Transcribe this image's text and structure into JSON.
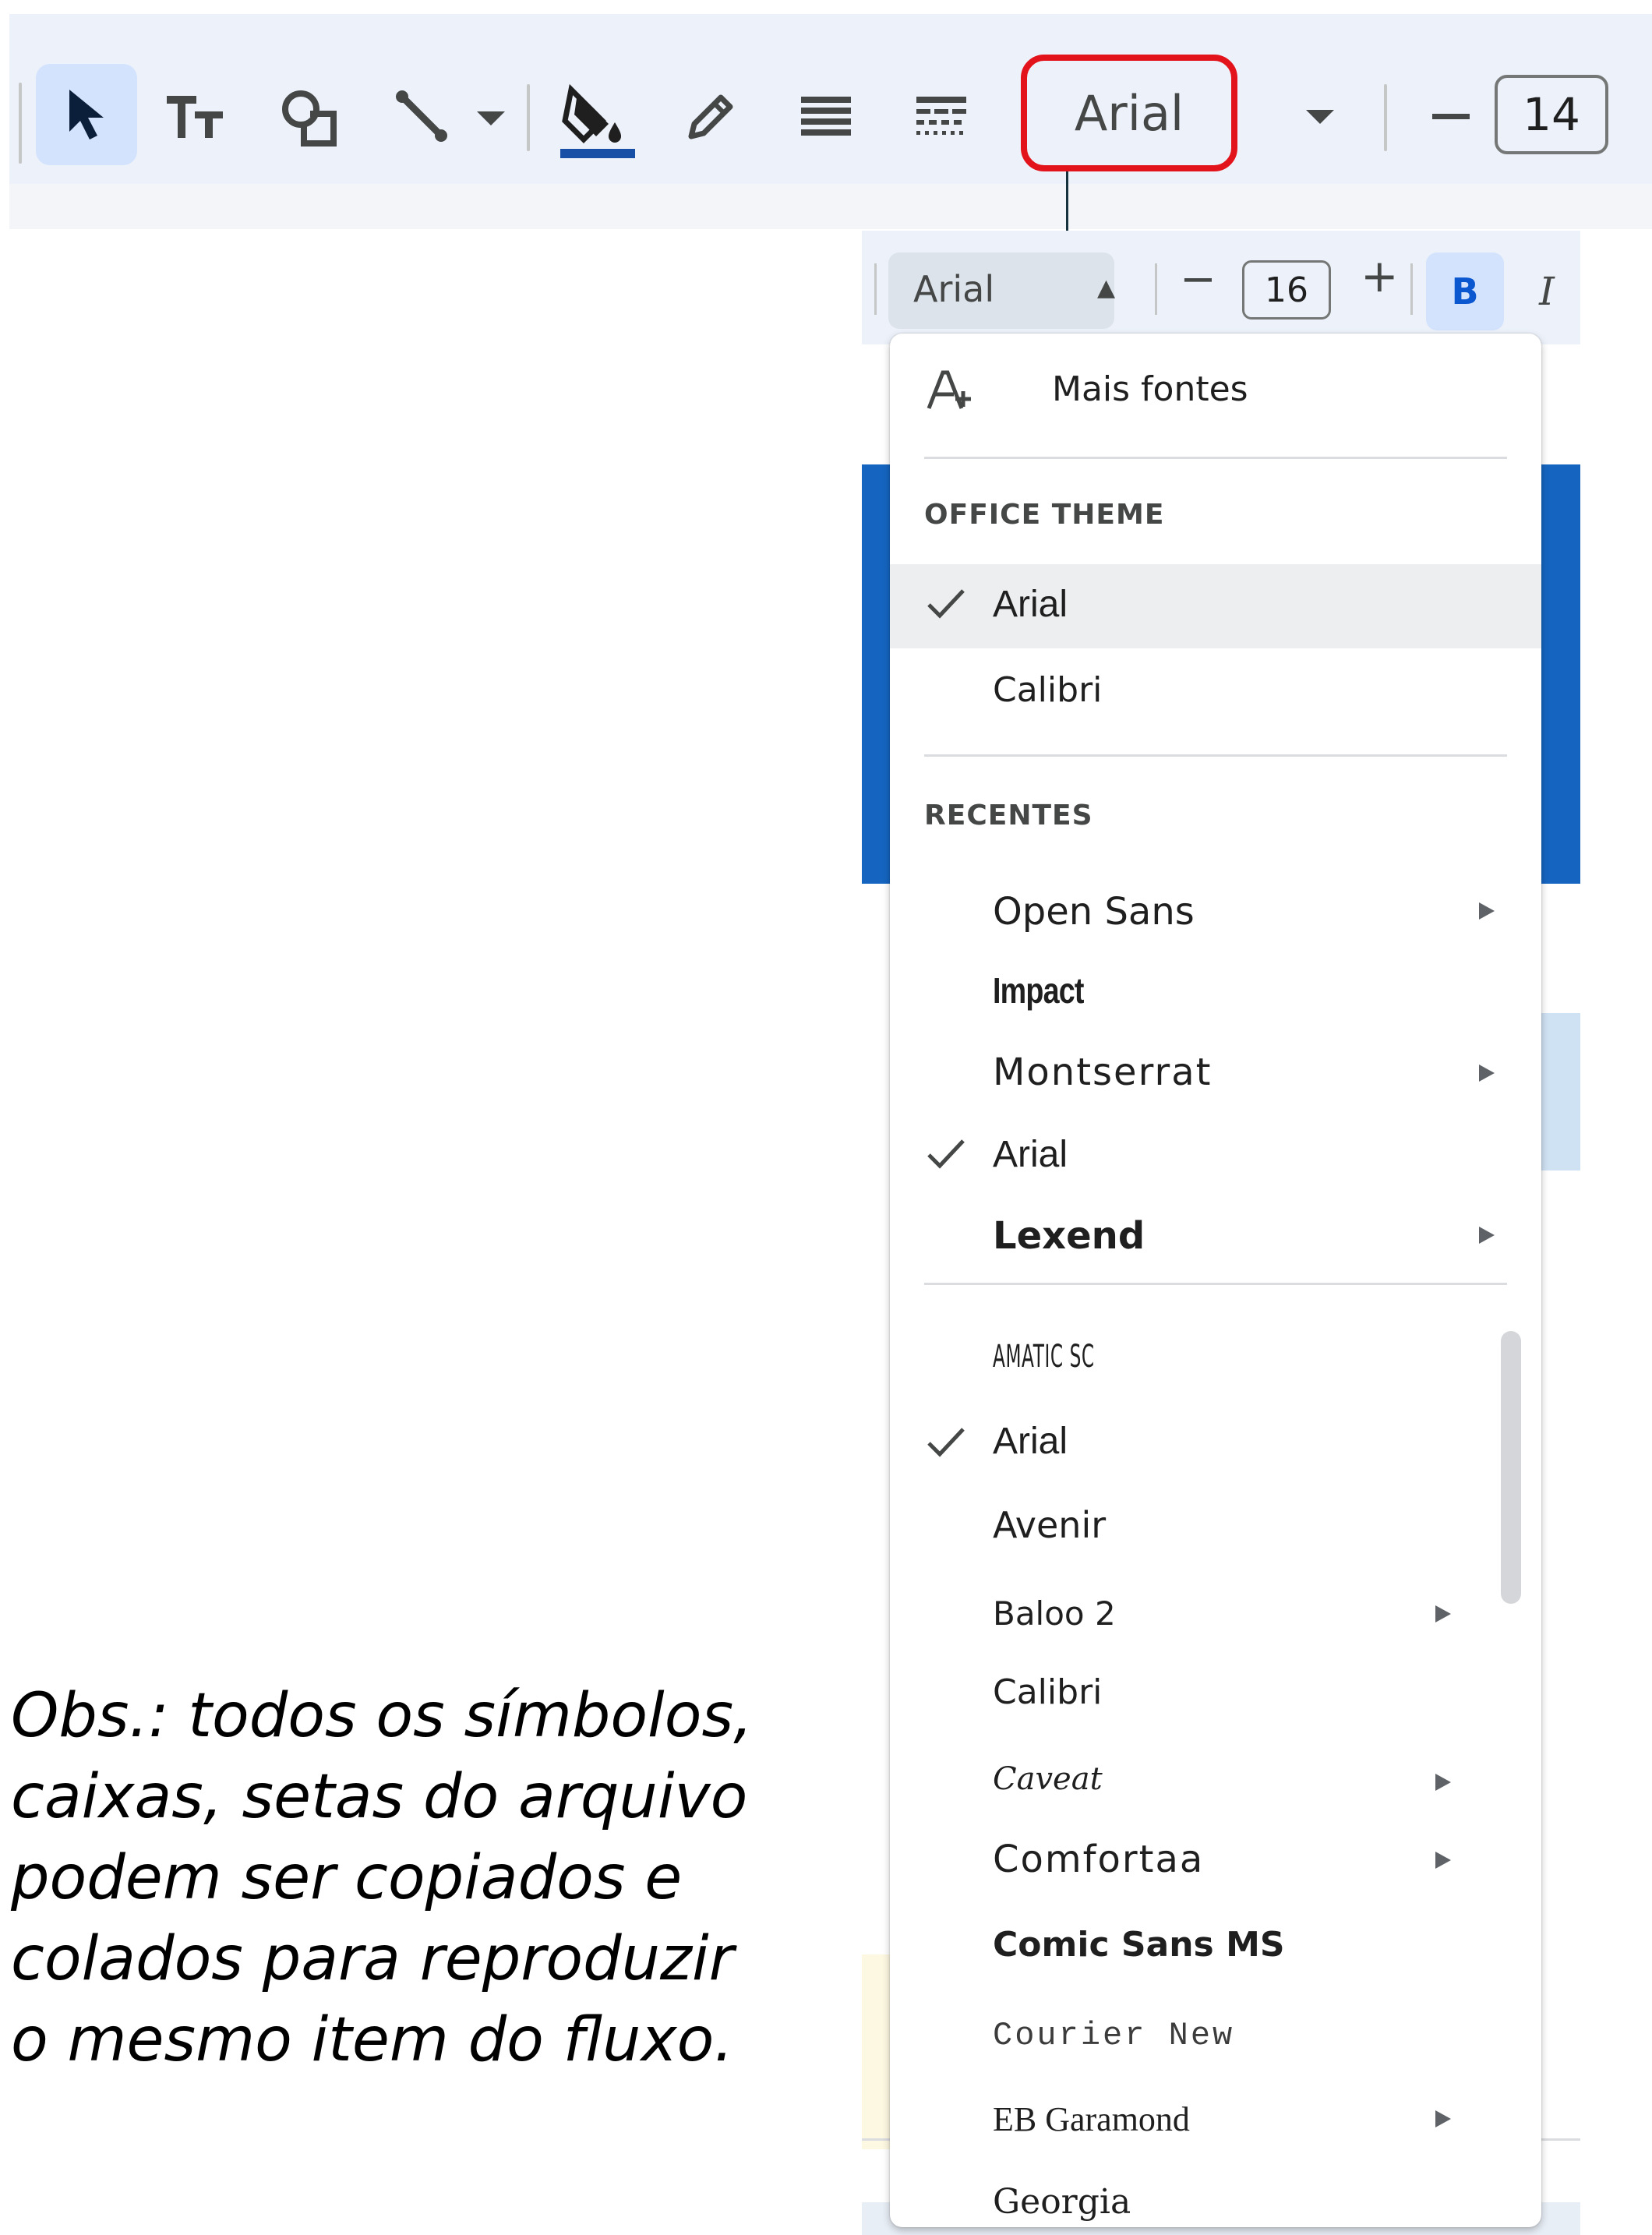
{
  "toolbar": {
    "font_name": "Arial",
    "font_size": "14",
    "accent": "#0b57d0",
    "highlight_color": "#e3131b",
    "icons": [
      "select-icon",
      "text-style-icon",
      "shapes-icon",
      "line-icon",
      "dropdown-icon",
      "fill-color-icon",
      "pen-icon",
      "line-weight-icon",
      "line-dash-icon",
      "font-dropdown-icon",
      "minus-icon"
    ]
  },
  "app": {
    "font_name": "Arial",
    "font_size": "16",
    "minus": "−",
    "plus": "+",
    "bold": "B",
    "italic": "I"
  },
  "menu": {
    "more_fonts": "Mais fontes",
    "office_theme_header": "OFFICE THEME",
    "office_theme": [
      {
        "label": "Arial",
        "checked": true,
        "selected": true
      },
      {
        "label": "Calibri",
        "checked": false
      }
    ],
    "recent_header": "RECENTES",
    "recent": [
      {
        "label": "Open Sans",
        "submenu": true
      },
      {
        "label": "Impact",
        "submenu": false
      },
      {
        "label": "Montserrat",
        "submenu": true
      },
      {
        "label": "Arial",
        "checked": true
      },
      {
        "label": "Lexend",
        "submenu": true
      }
    ],
    "all": [
      {
        "label": "AMATIC SC"
      },
      {
        "label": "Arial",
        "checked": true
      },
      {
        "label": "Avenir"
      },
      {
        "label": "Baloo 2",
        "submenu": true
      },
      {
        "label": "Calibri"
      },
      {
        "label": "Caveat",
        "submenu": true
      },
      {
        "label": "Comfortaa",
        "submenu": true
      },
      {
        "label": "Comic Sans MS"
      },
      {
        "label": "Courier New"
      },
      {
        "label": "EB Garamond",
        "submenu": true
      },
      {
        "label": "Georgia"
      }
    ]
  },
  "note": "Obs.: todos os símbolos, caixas, setas do arquivo podem ser copiados e colados para reproduzir o mesmo item do fluxo."
}
